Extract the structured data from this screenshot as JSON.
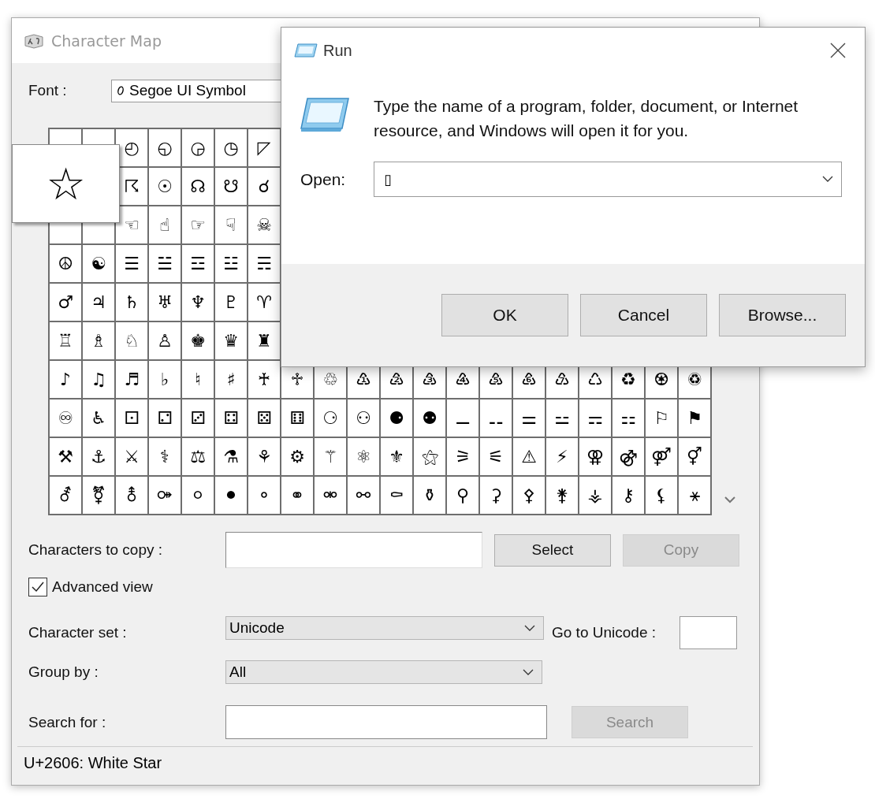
{
  "character_map": {
    "title": "Character Map",
    "font": {
      "label": "Font :",
      "value": "Segoe UI Symbol"
    },
    "grid": {
      "rows": [
        {
          "cells": [
            null,
            null,
            "◴",
            "◵",
            "◶",
            "◷",
            "◸"
          ]
        },
        {
          "cells": [
            null,
            null,
            "☈",
            "☉",
            "☊",
            "☋",
            "☌"
          ]
        },
        {
          "cells": [
            null,
            null,
            "☜",
            "☝",
            "☞",
            "☟",
            "☠"
          ]
        },
        {
          "cells": [
            "☮",
            "☯",
            "☰",
            "☱",
            "☲",
            "☳",
            "☴"
          ]
        },
        {
          "cells": [
            "♂",
            "♃",
            "♄",
            "♅",
            "♆",
            "♇",
            "♈"
          ]
        },
        {
          "cells": [
            "♖",
            "♗",
            "♘",
            "♙",
            "♚",
            "♛",
            "♜"
          ]
        },
        {
          "cells": [
            "♪",
            "♫",
            "♬",
            "♭",
            "♮",
            "♯",
            "♰",
            "♱",
            "♲",
            "♳",
            "♴",
            "♵",
            "♶",
            "♷",
            "♸",
            "♹",
            "♺",
            "♻",
            "♼",
            "♽"
          ]
        },
        {
          "cells": [
            "♾",
            "♿",
            "⚀",
            "⚁",
            "⚂",
            "⚃",
            "⚄",
            "⚅",
            "⚆",
            "⚇",
            "⚈",
            "⚉",
            "⚊",
            "⚋",
            "⚌",
            "⚍",
            "⚎",
            "⚏",
            "⚐",
            "⚑"
          ]
        },
        {
          "cells": [
            "⚒",
            "⚓",
            "⚔",
            "⚕",
            "⚖",
            "⚗",
            "⚘",
            "⚙",
            "⚚",
            "⚛",
            "⚜",
            "⚝",
            "⚞",
            "⚟",
            "⚠",
            "⚡",
            "⚢",
            "⚣",
            "⚤",
            "⚥"
          ]
        },
        {
          "cells": [
            "⚦",
            "⚧",
            "⚨",
            "⚩",
            "⚪",
            "⚫",
            "⚬",
            "⚭",
            "⚮",
            "⚯",
            "⚰",
            "⚱",
            "⚲",
            "⚳",
            "⚴",
            "⚵",
            "⚶",
            "⚷",
            "⚸",
            "⚹"
          ]
        }
      ]
    },
    "enlarged_character": "☆",
    "copy": {
      "label": "Characters to copy :"
    },
    "buttons": [
      {
        "label": "Select",
        "disabled": false
      },
      {
        "label": "Copy",
        "disabled": true
      }
    ],
    "advanced_view": {
      "label": "Advanced view",
      "checked": true
    },
    "character_set": {
      "label": "Character set :",
      "value": "Unicode"
    },
    "goto_unicode": {
      "label": "Go to Unicode :"
    },
    "group_by": {
      "label": "Group by :",
      "value": "All"
    },
    "search": {
      "label": "Search for :",
      "button": {
        "label": "Search",
        "disabled": true
      }
    },
    "status_bar": "U+2606: White Star"
  },
  "run": {
    "title": "Run",
    "message": "Type the name of a program, folder, document, or Internet resource, and Windows will open it for you.",
    "open": {
      "label": "Open:",
      "value": "▯"
    },
    "buttons": [
      {
        "label": "OK"
      },
      {
        "label": "Cancel"
      },
      {
        "label": "Browse..."
      }
    ]
  }
}
